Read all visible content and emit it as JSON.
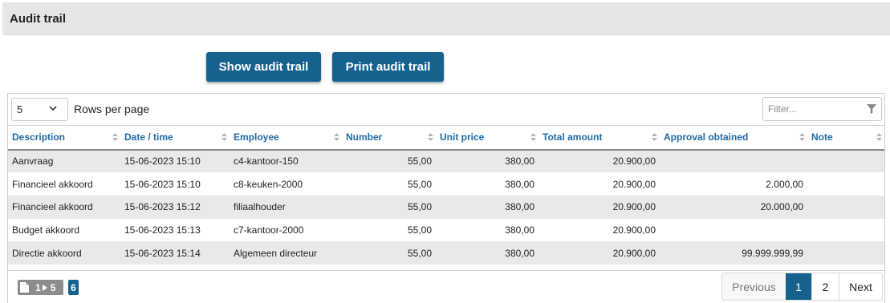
{
  "panel": {
    "title": "Audit trail"
  },
  "buttons": {
    "show": "Show audit trail",
    "print": "Print audit trail"
  },
  "toolbar": {
    "rows_per_page_value": "5",
    "rows_per_page_label": "Rows per page",
    "filter_placeholder": "Filter..."
  },
  "table": {
    "columns": [
      "Description",
      "Date / time",
      "Employee",
      "Number",
      "Unit price",
      "Total amount",
      "Approval obtained",
      "Note"
    ],
    "rows": [
      [
        "Aanvraag",
        "15-06-2023 15:10",
        "c4-kantoor-150",
        "55,00",
        "380,00",
        "20.900,00",
        "",
        ""
      ],
      [
        "Financieel akkoord",
        "15-06-2023 15:10",
        "c8-keuken-2000",
        "55,00",
        "380,00",
        "20.900,00",
        "2.000,00",
        ""
      ],
      [
        "Financieel akkoord",
        "15-06-2023 15:12",
        "filiaalhouder",
        "55,00",
        "380,00",
        "20.900,00",
        "20.000,00",
        ""
      ],
      [
        "Budget akkoord",
        "15-06-2023 15:13",
        "c7-kantoor-2000",
        "55,00",
        "380,00",
        "20.900,00",
        "",
        ""
      ],
      [
        "Directie akkoord",
        "15-06-2023 15:14",
        "Algemeen directeur",
        "55,00",
        "380,00",
        "20.900,00",
        "99.999.999,99",
        ""
      ]
    ]
  },
  "footer": {
    "range_start": "1",
    "range_end": "5",
    "total": "6"
  },
  "pagination": {
    "previous": "Previous",
    "pages": [
      "1",
      "2"
    ],
    "next": "Next",
    "current": "1"
  },
  "colors": {
    "primary": "#15628f",
    "header_text": "#1f6aa5",
    "stripe": "#e9e9e9"
  }
}
